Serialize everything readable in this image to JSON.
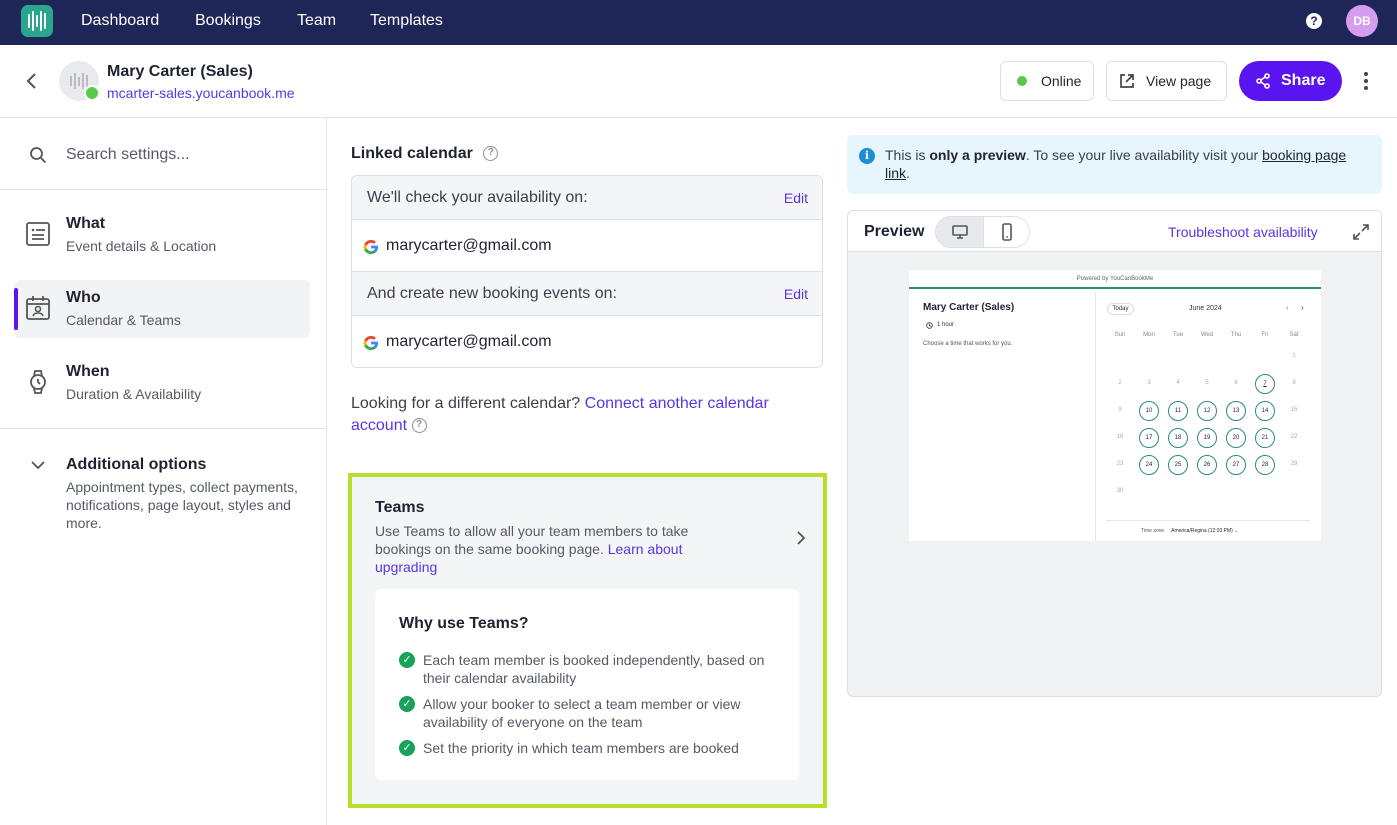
{
  "topnav": {
    "items": [
      "Dashboard",
      "Bookings",
      "Team",
      "Templates"
    ],
    "help": "?",
    "avatar": "DB",
    "colors": {
      "bg": "#1e2557",
      "logo": "#2aa58e",
      "avatar": "#d59cf0"
    }
  },
  "header": {
    "name": "Mary Carter (Sales)",
    "url": "mcarter-sales.youcanbook.me",
    "online_label": "Online",
    "view_label": "View page",
    "share_label": "Share",
    "colors": {
      "accent": "#5a14f0",
      "online": "#58c94a"
    }
  },
  "sidebar": {
    "search_placeholder": "Search settings...",
    "items": [
      {
        "title": "What",
        "sub": "Event details & Location",
        "icon": "document-icon"
      },
      {
        "title": "Who",
        "sub": "Calendar & Teams",
        "icon": "calendar-person-icon",
        "active": true
      },
      {
        "title": "When",
        "sub": "Duration & Availability",
        "icon": "watch-icon"
      }
    ],
    "additional": {
      "title": "Additional options",
      "desc": "Appointment types, collect payments, notifications, page layout, styles and more."
    }
  },
  "linked": {
    "title": "Linked calendar",
    "check_label": "We'll check your availability on:",
    "create_label": "And create new booking events on:",
    "edit_label": "Edit",
    "check_email": "marycarter@gmail.com",
    "create_email": "marycarter@gmail.com",
    "looking_text": "Looking for a different calendar?",
    "connect_link": "Connect another calendar account"
  },
  "teams": {
    "title": "Teams",
    "desc": "Use Teams to allow all your team members to take bookings on the same booking page.",
    "learn_link": "Learn about upgrading",
    "why_title": "Why use Teams?",
    "reasons": [
      "Each team member is booked independently, based on their calendar availability",
      "Allow your booker to select a team member or view availability of everyone on the team",
      "Set the priority in which team members are booked"
    ],
    "highlight_color": "#b6e02a"
  },
  "info": {
    "pre": "This is",
    "bold": "only a preview",
    "mid": ". To see your live availability visit your",
    "link": "booking page link",
    "end": "."
  },
  "preview": {
    "title": "Preview",
    "troubleshoot": "Troubleshoot availability",
    "mini": {
      "powered": "Powered by YouCanBookMe",
      "name": "Mary Carter (Sales)",
      "duration": "1 hour",
      "choose": "Choose a time that works for you.",
      "today": "Today",
      "month": "June 2024",
      "dow": [
        "Sun",
        "Mon",
        "Tue",
        "Wed",
        "Thu",
        "Fri",
        "Sat"
      ],
      "days": [
        [
          "",
          "",
          "",
          "",
          "",
          "",
          "1"
        ],
        [
          "2",
          "3",
          "4",
          "5",
          "6",
          "7",
          "8"
        ],
        [
          "9",
          "10",
          "11",
          "12",
          "13",
          "14",
          "15"
        ],
        [
          "16",
          "17",
          "18",
          "19",
          "20",
          "21",
          "22"
        ],
        [
          "23",
          "24",
          "25",
          "26",
          "27",
          "28",
          "29"
        ],
        [
          "30",
          "",
          "",
          "",
          "",
          "",
          ""
        ]
      ],
      "available": [
        "10",
        "11",
        "12",
        "13",
        "14",
        "17",
        "18",
        "19",
        "20",
        "21",
        "24",
        "25",
        "26",
        "27",
        "28"
      ],
      "today_day": "7",
      "tz_label": "Time zone",
      "tz_value": "America/Regina (12:03 PM)"
    }
  }
}
